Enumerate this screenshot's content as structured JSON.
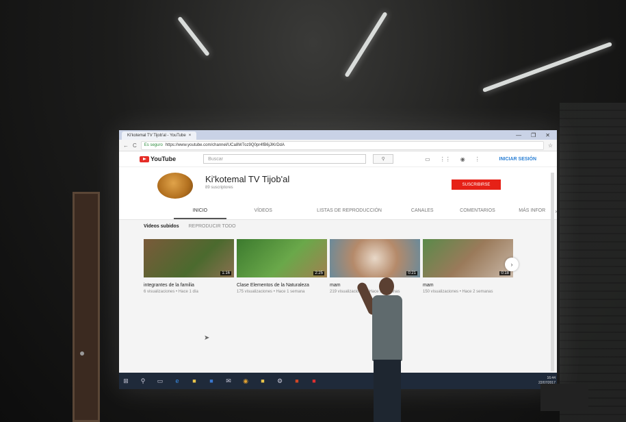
{
  "browser": {
    "tab_title": "Ki'kotemal TV Tijob'al - YouTube",
    "tab_close": "×",
    "secure_label": "Es seguro",
    "url": "https://www.youtube.com/channel/UCa8W7oz9Q0pr4fB6jJlKrDdA",
    "window_controls": [
      "—",
      "❐",
      "✕"
    ],
    "nav_back": "←",
    "nav_reload": "C"
  },
  "youtube": {
    "logo_text": "YouTube",
    "search_placeholder": "Buscar",
    "signin_label": "INICIAR SESIÓN"
  },
  "channel": {
    "name": "Ki'kotemal TV Tijob'al",
    "subscribers": "89 suscriptores",
    "subscribe_label": "SUSCRIBIRSE"
  },
  "tabs": [
    {
      "label": "INICIO",
      "active": true
    },
    {
      "label": "VÍDEOS"
    },
    {
      "label": "LISTAS DE REPRODUCCIÓN"
    },
    {
      "label": "CANALES"
    },
    {
      "label": "COMENTARIOS"
    },
    {
      "label": "MÁS INFOR"
    }
  ],
  "uploads": {
    "title": "Videos subidos",
    "play_all": "REPRODUCIR TODO"
  },
  "videos": [
    {
      "title": "integrantes de la familia",
      "meta": "6 visualizaciones • Hace 1 día",
      "duration": "1:16",
      "colors": [
        "#7a5a3a",
        "#4b6a2e"
      ]
    },
    {
      "title": "Clase Elementos de la Naturaleza",
      "meta": "175 visualizaciones • Hace 1 semana",
      "duration": "2:25",
      "colors": [
        "#3c7a2e",
        "#6aa84a"
      ]
    },
    {
      "title": "mam",
      "meta": "219 visualizaciones • Hace 2 semanas",
      "duration": "0:21",
      "colors": [
        "#b58a6a",
        "#e8d8c8"
      ]
    },
    {
      "title": "mam",
      "meta": "150 visualizaciones • Hace 2 semanas",
      "duration": "0:18",
      "colors": [
        "#5a8a4a",
        "#9a7a5a"
      ]
    }
  ],
  "taskbar": {
    "time": "16:44",
    "date": "22/07/2017"
  }
}
